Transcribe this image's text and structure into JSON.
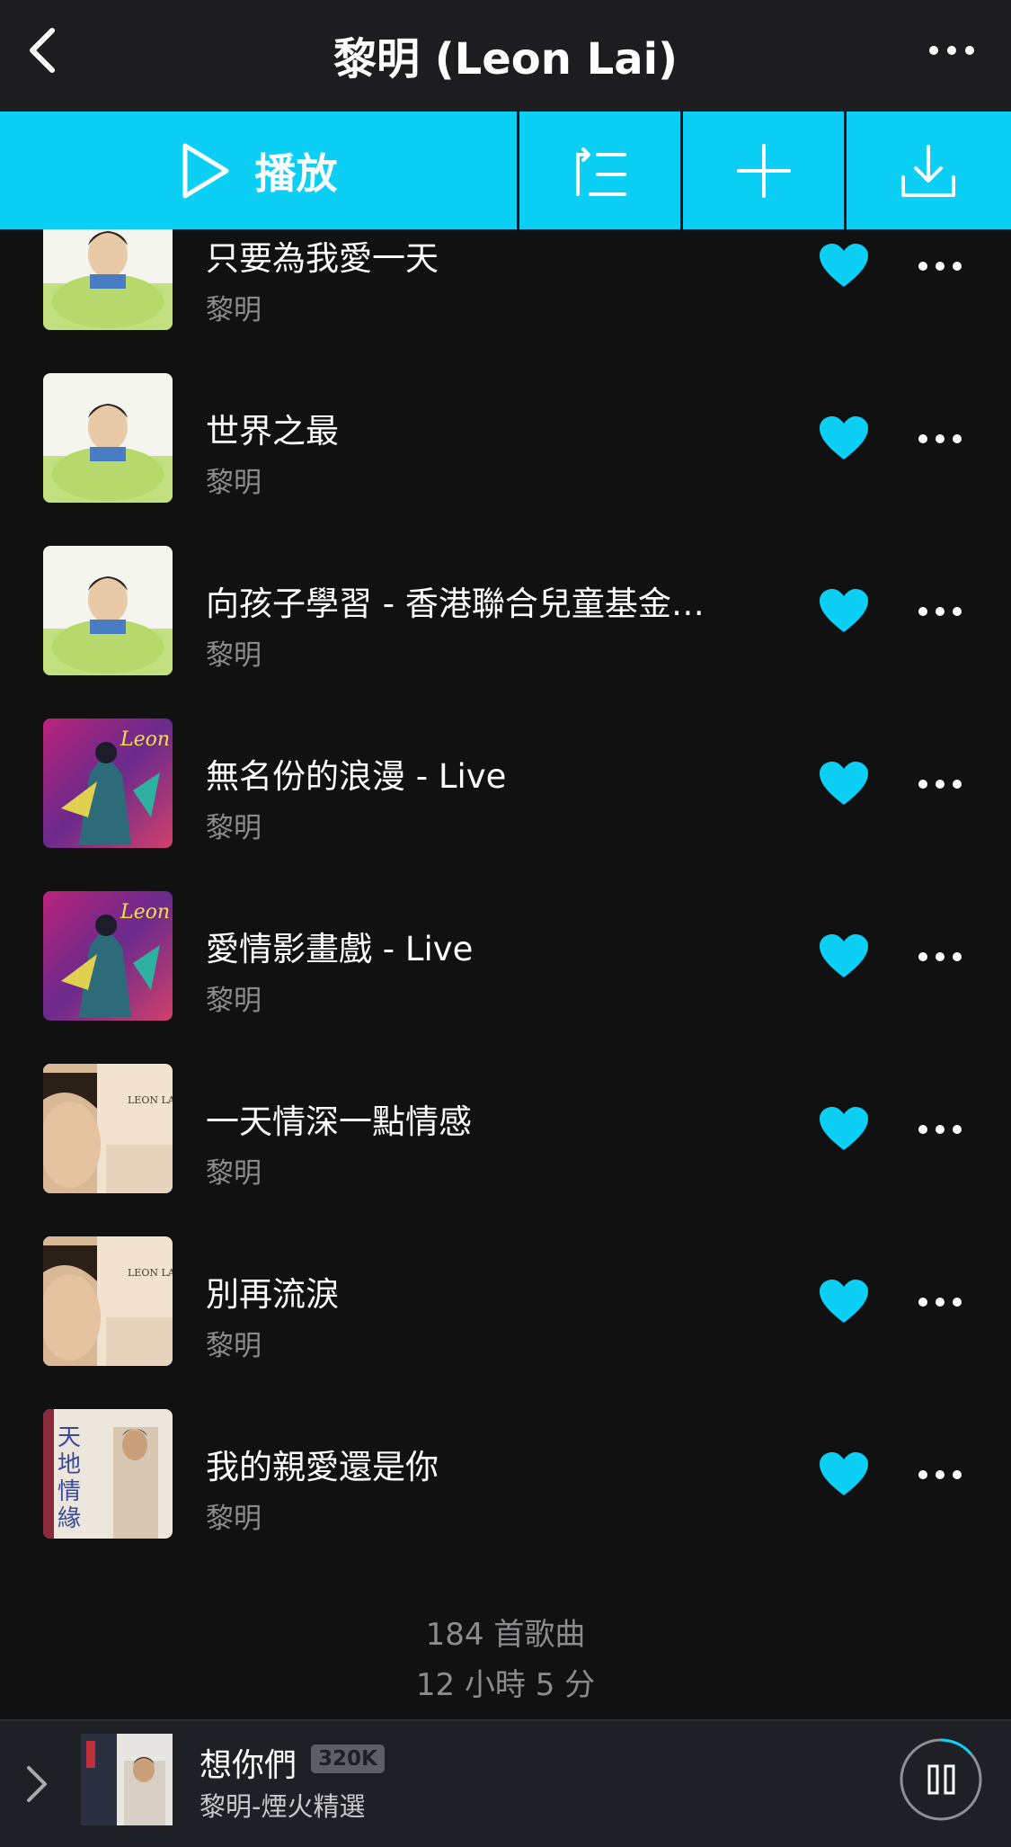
{
  "header": {
    "title": "黎明 (Leon Lai)"
  },
  "toolbar": {
    "play_label": "播放"
  },
  "songs": [
    {
      "title": "只要為我愛一天",
      "artist": "黎明",
      "cover": "green"
    },
    {
      "title": "世界之最",
      "artist": "黎明",
      "cover": "green"
    },
    {
      "title": "向孩子學習 - 香港聯合兒童基金…",
      "artist": "黎明",
      "cover": "green"
    },
    {
      "title": "無名份的浪漫 - Live",
      "artist": "黎明",
      "cover": "live"
    },
    {
      "title": "愛情影畫戲 - Live",
      "artist": "黎明",
      "cover": "live"
    },
    {
      "title": "一天情深一點情感",
      "artist": "黎明",
      "cover": "beige"
    },
    {
      "title": "別再流淚",
      "artist": "黎明",
      "cover": "beige"
    },
    {
      "title": "我的親愛還是你",
      "artist": "黎明",
      "cover": "tiandi"
    }
  ],
  "stats": {
    "count": "184 首歌曲",
    "duration": "12 小時 5 分"
  },
  "cover_text": {
    "live_leon": "Leon",
    "leon_lai": "LEON LAI",
    "tiandi": "天地情緣"
  },
  "now_playing": {
    "title": "想你們",
    "badge": "320K",
    "subtitle": "黎明-煙火精選"
  },
  "colors": {
    "accent": "#0bcff5",
    "background": "#111112",
    "header": "#1d1d1f",
    "player": "#1e2025",
    "muted_text": "#8c8c8e"
  }
}
